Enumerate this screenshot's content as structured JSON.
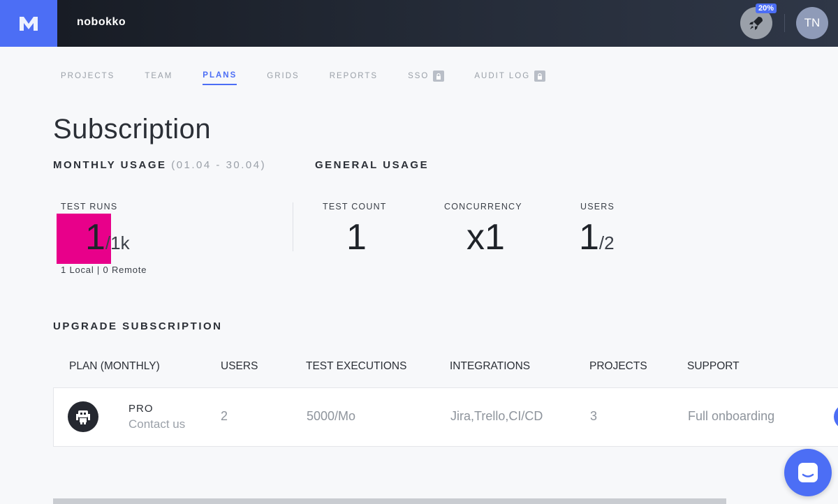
{
  "header": {
    "org_name": "nobokko",
    "promo_badge": "20%",
    "avatar_initials": "TN",
    "brand_color": "#4c6ef5"
  },
  "tabs": [
    {
      "label": "PROJECTS",
      "active": false,
      "locked": false
    },
    {
      "label": "TEAM",
      "active": false,
      "locked": false
    },
    {
      "label": "PLANS",
      "active": true,
      "locked": false
    },
    {
      "label": "GRIDS",
      "active": false,
      "locked": false
    },
    {
      "label": "REPORTS",
      "active": false,
      "locked": false
    },
    {
      "label": "SSO",
      "active": false,
      "locked": true
    },
    {
      "label": "AUDIT LOG",
      "active": false,
      "locked": true
    }
  ],
  "page": {
    "title": "Subscription"
  },
  "monthly_usage": {
    "heading": "MONTHLY USAGE",
    "period": "(01.04 - 30.04)",
    "test_runs": {
      "label": "TEST RUNS",
      "value": "1",
      "limit": "/1k",
      "breakdown": "1 Local | 0 Remote"
    }
  },
  "general_usage": {
    "heading": "GENERAL USAGE",
    "test_count": {
      "label": "TEST COUNT",
      "value": "1"
    },
    "concurrency": {
      "label": "CONCURRENCY",
      "value": "x1"
    },
    "users": {
      "label": "USERS",
      "value": "1",
      "limit": "/2"
    }
  },
  "upgrade": {
    "heading": "UPGRADE SUBSCRIPTION",
    "columns": [
      "PLAN (MONTHLY)",
      "USERS",
      "TEST EXECUTIONS",
      "INTEGRATIONS",
      "PROJECTS",
      "SUPPORT"
    ],
    "plans": [
      {
        "name": "PRO",
        "price_text": "Contact us",
        "users": "2",
        "test_executions": "5000/Mo",
        "integrations": "Jira,Trello,CI/CD",
        "projects": "3",
        "support": "Full onboarding"
      }
    ]
  }
}
